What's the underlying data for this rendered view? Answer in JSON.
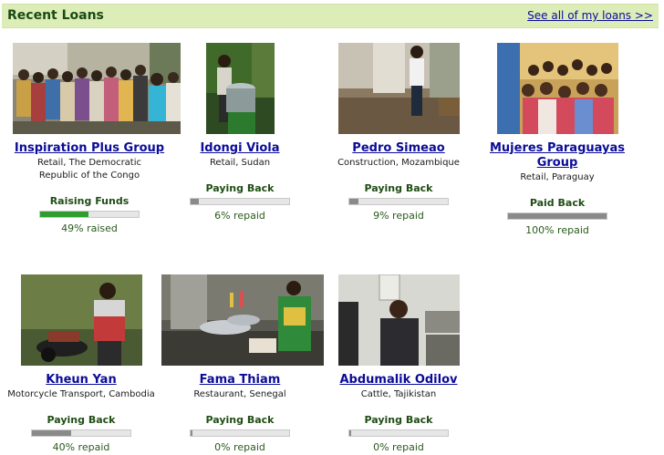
{
  "header": {
    "title": "Recent Loans",
    "see_all_link": "See all of my loans >>"
  },
  "colors": {
    "fill_raising": "#2e9f2e",
    "fill_paying": "#8a8a8a",
    "fill_paid": "#8a8a8a",
    "link": "#0b0b99",
    "status_text": "#1f4d14"
  },
  "loans": [
    {
      "name": "Inspiration Plus Group",
      "sector": "Retail, The Democratic Republic of the Congo",
      "status": "Raising Funds",
      "progress": 0.49,
      "progress_text": "49% raised",
      "fill_color": "#2e9f2e"
    },
    {
      "name": "Idongi Viola",
      "sector": "Retail, Sudan",
      "status": "Paying Back",
      "progress": 0.06,
      "progress_text": "6% repaid",
      "fill_color": "#8a8a8a"
    },
    {
      "name": "Pedro Simeao",
      "sector": "Construction, Mozambique",
      "status": "Paying Back",
      "progress": 0.09,
      "progress_text": "9% repaid",
      "fill_color": "#8a8a8a"
    },
    {
      "name": "Mujeres Paraguayas Group",
      "sector": "Retail, Paraguay",
      "status": "Paid Back",
      "progress": 1.0,
      "progress_text": "100% repaid",
      "fill_color": "#8a8a8a"
    },
    {
      "name": "Kheun Yan",
      "sector": "Motorcycle Transport, Cambodia",
      "status": "Paying Back",
      "progress": 0.4,
      "progress_text": "40% repaid",
      "fill_color": "#8a8a8a"
    },
    {
      "name": "Fama Thiam",
      "sector": "Restaurant, Senegal",
      "status": "Paying Back",
      "progress": 0.0,
      "progress_text": "0% repaid",
      "fill_color": "#8a8a8a"
    },
    {
      "name": "Abdumalik Odilov",
      "sector": "Cattle, Tajikistan",
      "status": "Paying Back",
      "progress": 0.0,
      "progress_text": "0% repaid",
      "fill_color": "#8a8a8a"
    }
  ]
}
